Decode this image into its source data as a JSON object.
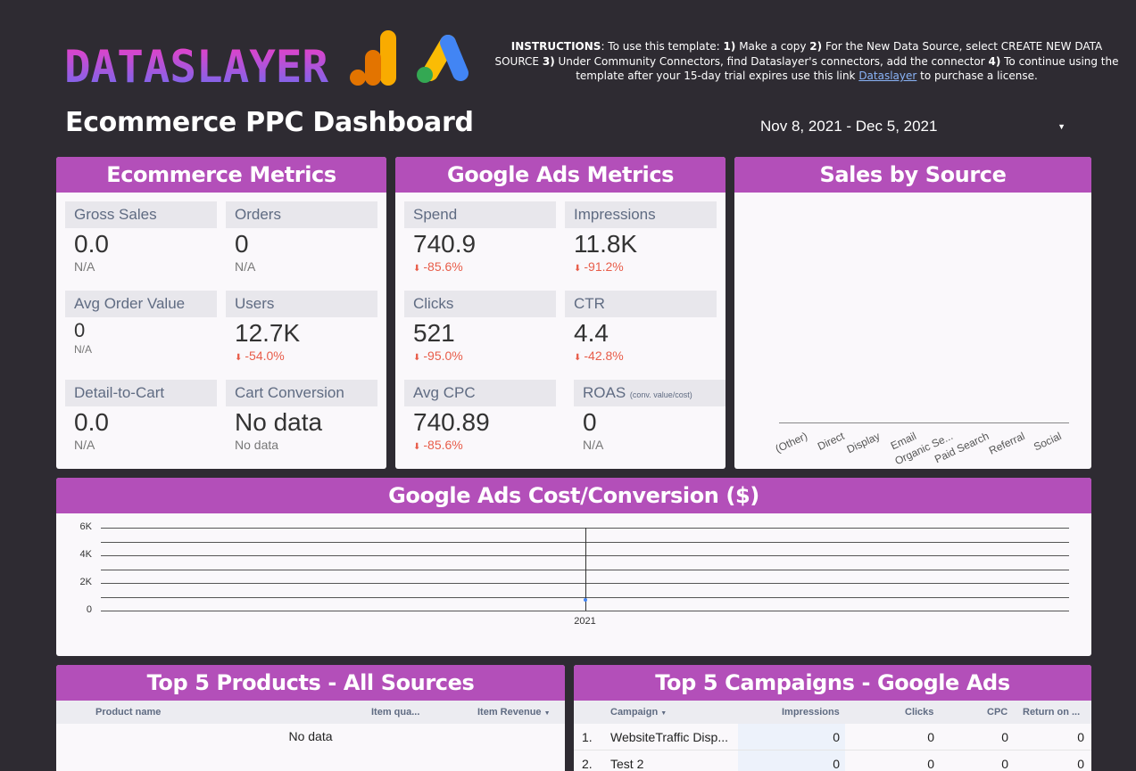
{
  "brand": {
    "logo_text": "DATASLAYER",
    "ga_logo": "google-analytics-icon",
    "ads_logo": "google-ads-icon"
  },
  "instructions": {
    "heading": "INSTRUCTIONS",
    "intro": ": To use this template: ",
    "s1n": "1)",
    "s1": " Make a copy ",
    "s2n": "2)",
    "s2": " For the New Data Source, select CREATE NEW DATA SOURCE ",
    "s3n": "3)",
    "s3": " Under Community Connectors, find Dataslayer's connectors, add the connector ",
    "s4n": "4)",
    "s4": " To continue using the template after your 15-day trial expires use this link ",
    "link": "Dataslayer",
    "tail": " to purchase a license."
  },
  "page_title": "Ecommerce PPC Dashboard",
  "date_range": "Nov 8, 2021 - Dec 5, 2021",
  "colors": {
    "accent": "#b34fb9",
    "background": "#2e2b32",
    "negative": "#e85d4a",
    "card": "#faf8fb"
  },
  "ecommerce": {
    "title": "Ecommerce Metrics",
    "gross_sales": {
      "label": "Gross Sales",
      "value": "0.0",
      "sub": "N/A"
    },
    "orders": {
      "label": "Orders",
      "value": "0",
      "sub": "N/A"
    },
    "aov": {
      "label": "Avg Order Value",
      "value": "0",
      "sub": "N/A"
    },
    "users": {
      "label": "Users",
      "value": "12.7K",
      "delta": "-54.0%"
    },
    "detail_to_cart": {
      "label": "Detail-to-Cart",
      "value": "0.0",
      "sub": "N/A"
    },
    "cart_conversion": {
      "label": "Cart Conversion",
      "value": "No data",
      "sub": "No data"
    }
  },
  "ads": {
    "title": "Google Ads Metrics",
    "spend": {
      "label": "Spend",
      "value": "740.9",
      "delta": "-85.6%"
    },
    "impressions": {
      "label": "Impressions",
      "value": "11.8K",
      "delta": "-91.2%"
    },
    "clicks": {
      "label": "Clicks",
      "value": "521",
      "delta": "-95.0%"
    },
    "ctr": {
      "label": "CTR",
      "value": "4.4",
      "delta": "-42.8%"
    },
    "avg_cpc": {
      "label": "Avg CPC",
      "value": "740.89",
      "delta": "-85.6%"
    },
    "roas": {
      "label": "ROAS",
      "label_note": "(conv. value/cost)",
      "value": "0",
      "sub": "N/A"
    }
  },
  "sales_by_source": {
    "title": "Sales by Source",
    "chart_data": {
      "type": "bar",
      "categories": [
        "(Other)",
        "Direct",
        "Display",
        "Email",
        "Organic Se...",
        "Paid Search",
        "Referral",
        "Social"
      ],
      "values": [
        0,
        0,
        0,
        0,
        0,
        0,
        0,
        0
      ]
    }
  },
  "cost_conversion": {
    "title": "Google Ads  Cost/Conversion ($)",
    "chart_data": {
      "type": "line",
      "x": [
        "2021"
      ],
      "values": [
        0
      ],
      "y_ticks": [
        "6K",
        "4K",
        "2K",
        "0"
      ],
      "ylim": [
        0,
        6000
      ],
      "grid": true
    }
  },
  "products": {
    "title": "Top 5 Products - All Sources",
    "columns": [
      "Product name",
      "Item qua...",
      "Item Revenue"
    ],
    "sort_icon": "sort-desc-icon",
    "empty": "No data"
  },
  "campaigns": {
    "title": "Top 5 Campaigns - Google Ads",
    "columns": [
      "Campaign",
      "Impressions",
      "Clicks",
      "CPC",
      "Return on ..."
    ],
    "rows": [
      {
        "n": "1.",
        "campaign": "WebsiteTraffic Disp...",
        "impressions": "0",
        "clicks": "0",
        "cpc": "0",
        "roas": "0"
      },
      {
        "n": "2.",
        "campaign": "Test 2",
        "impressions": "0",
        "clicks": "0",
        "cpc": "0",
        "roas": "0"
      }
    ]
  }
}
